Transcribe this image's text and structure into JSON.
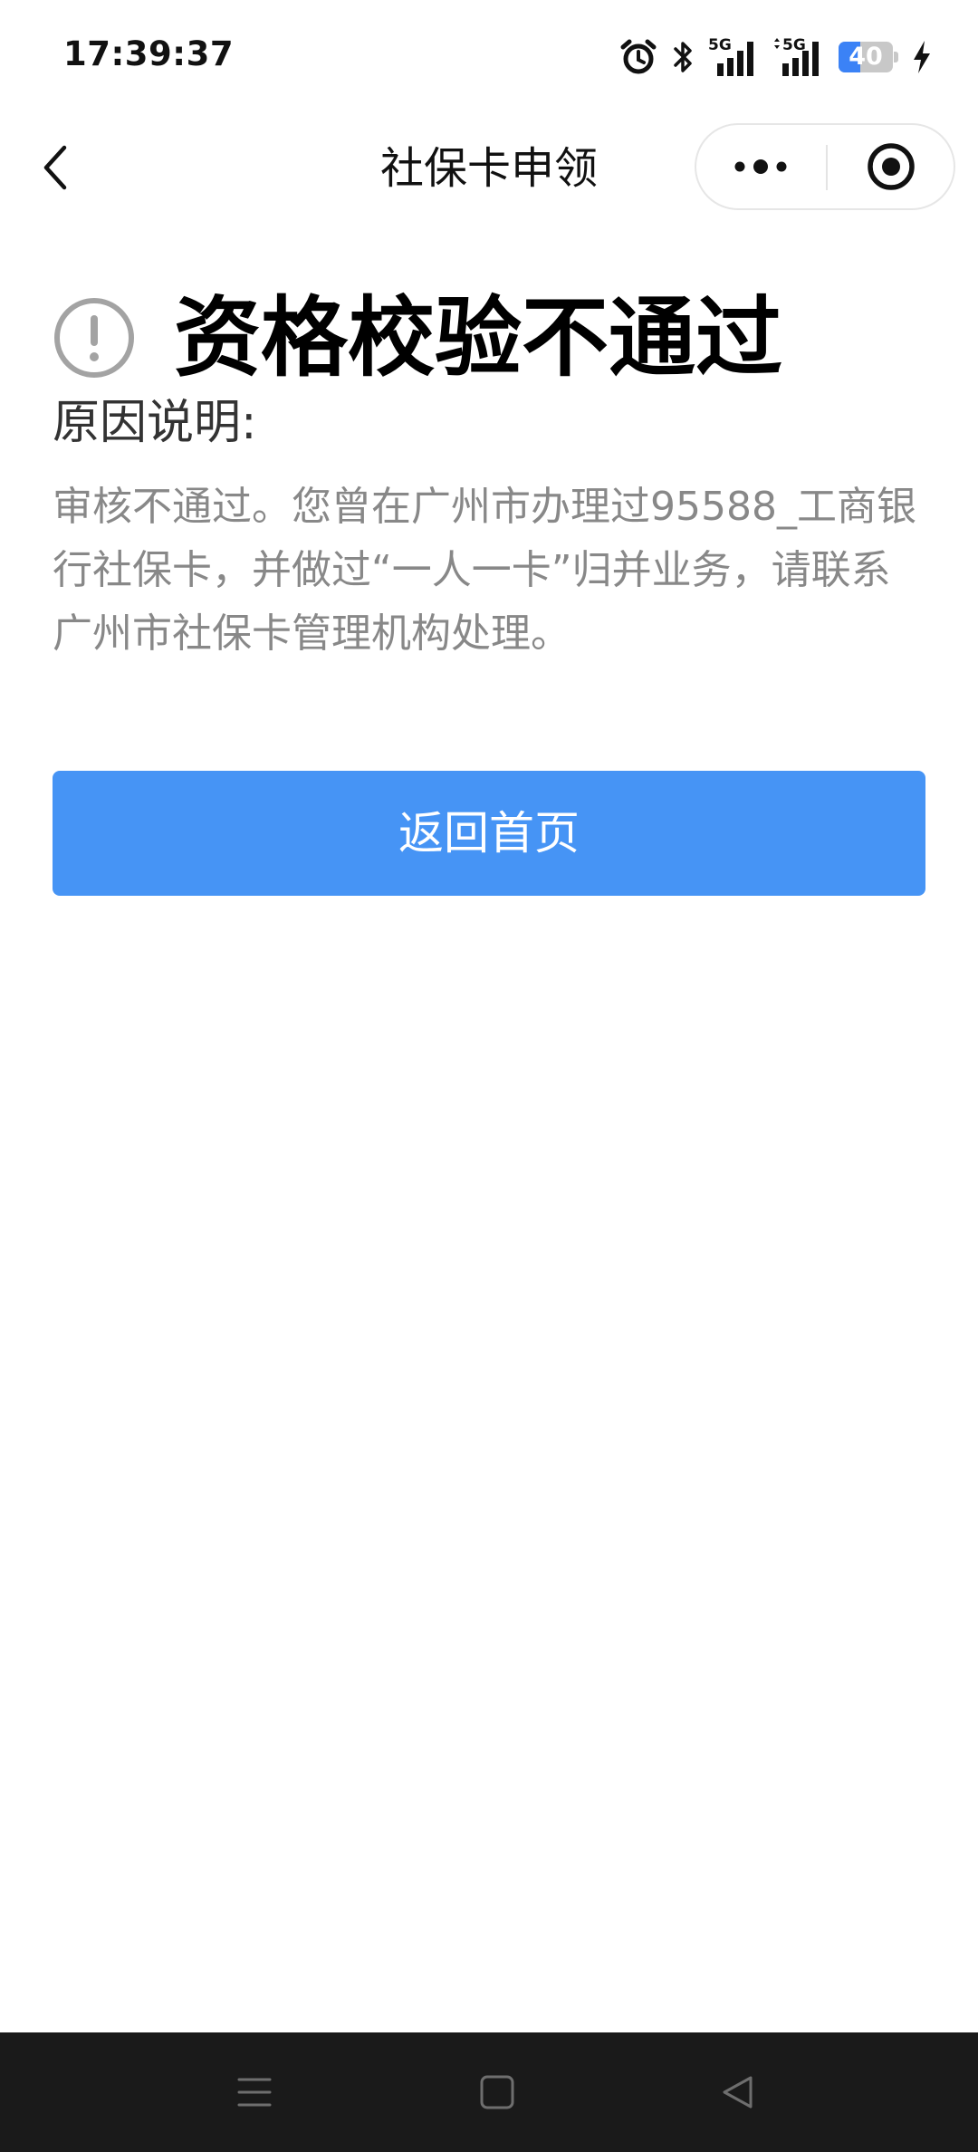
{
  "status_bar": {
    "time": "17:39:37",
    "network_1": "5G",
    "network_2": "5G",
    "battery_level": "40",
    "battery_fraction": 0.4,
    "icons": [
      "alarm-icon",
      "bluetooth-icon",
      "signal-5g-icon",
      "signal-5g-icon",
      "battery-icon",
      "charging-icon"
    ]
  },
  "nav": {
    "title": "社保卡申领",
    "icons": [
      "back-arrow-icon",
      "more-dots-icon",
      "close-target-icon"
    ]
  },
  "result": {
    "title": "资格校验不通过",
    "reason_label": "原因说明:",
    "reason_text": "审核不通过。您曾在广州市办理过95588_工商银行社保卡，并做过“一人一卡”归并业务，请联系广州市社保卡管理机构处理。",
    "icon": "warning-circle-icon"
  },
  "actions": {
    "home_button": "返回首页"
  },
  "colors": {
    "primary": "#4694f5",
    "battery_accent": "#3b82f6",
    "system_nav_bg": "#1a1a1a"
  }
}
